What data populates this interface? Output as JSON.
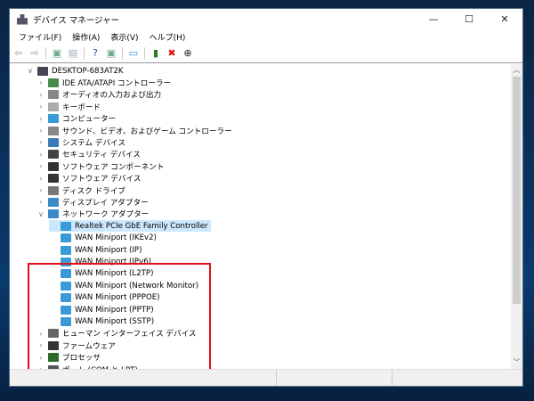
{
  "window": {
    "title": "デバイス マネージャー",
    "minimize": "—",
    "maximize": "☐",
    "close": "✕"
  },
  "menu": [
    "ファイル(F)",
    "操作(A)",
    "表示(V)",
    "ヘルプ(H)"
  ],
  "toolbar": [
    {
      "icon": "back-arrow-icon",
      "glyph": "⇦",
      "color": "#999"
    },
    {
      "icon": "forward-arrow-icon",
      "glyph": "⇨",
      "color": "#999"
    },
    {
      "icon": "properties-icon",
      "glyph": "▣",
      "color": "#6a8"
    },
    {
      "icon": "details-icon",
      "glyph": "▤",
      "color": "#9ab"
    },
    {
      "icon": "help-icon",
      "glyph": "?",
      "color": "#2a4ec0"
    },
    {
      "icon": "view-icon",
      "glyph": "▣",
      "color": "#6a8"
    },
    {
      "icon": "monitor-scan-icon",
      "glyph": "▭",
      "color": "#3a8fd8"
    },
    {
      "icon": "add-driver-icon",
      "glyph": "▮",
      "color": "#2a7a2a"
    },
    {
      "icon": "uninstall-icon",
      "glyph": "✖",
      "color": "#e01010"
    },
    {
      "icon": "update-driver-icon",
      "glyph": "⊕",
      "color": "#222"
    }
  ],
  "tree": {
    "root": "DESKTOP-683AT2K",
    "items": [
      {
        "label": "IDE ATA/ATAPI コントローラー",
        "color": "#4a8a4a"
      },
      {
        "label": "オーディオの入力および出力",
        "color": "#888"
      },
      {
        "label": "キーボード",
        "color": "#aaa"
      },
      {
        "label": "コンピューター",
        "color": "#3a9ad8"
      },
      {
        "label": "サウンド、ビデオ、およびゲーム コントローラー",
        "color": "#888"
      },
      {
        "label": "システム デバイス",
        "color": "#3a7ab8"
      },
      {
        "label": "セキュリティ デバイス",
        "color": "#444"
      },
      {
        "label": "ソフトウェア コンポーネント",
        "color": "#333"
      },
      {
        "label": "ソフトウェア デバイス",
        "color": "#333"
      },
      {
        "label": "ディスク ドライブ",
        "color": "#777"
      },
      {
        "label": "ディスプレイ アダプター",
        "color": "#3a8ac8"
      }
    ],
    "network": {
      "label": "ネットワーク アダプター",
      "children": [
        "Realtek PCIe GbE Family Controller",
        "WAN Miniport (IKEv2)",
        "WAN Miniport (IP)",
        "WAN Miniport (IPv6)",
        "WAN Miniport (L2TP)",
        "WAN Miniport (Network Monitor)",
        "WAN Miniport (PPPOE)",
        "WAN Miniport (PPTP)",
        "WAN Miniport (SSTP)"
      ]
    },
    "after": [
      {
        "label": "ヒューマン インターフェイス デバイス",
        "color": "#666"
      },
      {
        "label": "ファームウェア",
        "color": "#333"
      },
      {
        "label": "プロセッサ",
        "color": "#2a6a2a"
      },
      {
        "label": "ポート (COM と LPT)",
        "color": "#555"
      }
    ]
  },
  "highlight_color": "#e0101a"
}
